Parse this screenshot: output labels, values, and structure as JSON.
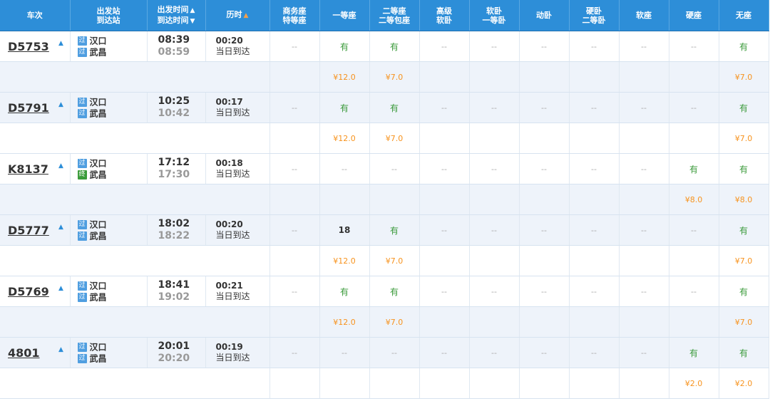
{
  "headers": {
    "train": "车次",
    "station_from": "出发站",
    "station_to": "到达站",
    "time_depart": "出发时间",
    "time_arrive": "到达时间",
    "duration": "历时",
    "business_1": "商务座",
    "business_2": "特等座",
    "first": "一等座",
    "second_1": "二等座",
    "second_2": "二等包座",
    "high_1": "高级",
    "high_2": "软卧",
    "soft_sleep_1": "软卧",
    "soft_sleep_2": "一等卧",
    "dong_sleep": "动卧",
    "hard_sleep_1": "硬卧",
    "hard_sleep_2": "二等卧",
    "soft_seat": "软座",
    "hard_seat": "硬座",
    "no_seat": "无座"
  },
  "icons": {
    "tag_pass": "过",
    "tag_end": "终",
    "sort_up": "▲",
    "sort_down": "▼"
  },
  "colors": {
    "header_bg": "#2d8ed8",
    "available": "#3a9a3a",
    "price": "#f7931e"
  },
  "trains": [
    {
      "no": "D5753",
      "from": "汉口",
      "to": "武昌",
      "to_tag": "过",
      "depart": "08:39",
      "arrive": "08:59",
      "duration": "00:20",
      "arrive_day": "当日到达",
      "seats": [
        "--",
        "有",
        "有",
        "--",
        "--",
        "--",
        "--",
        "--",
        "--",
        "有"
      ],
      "prices": [
        "",
        "¥12.0",
        "¥7.0",
        "",
        "",
        "",
        "",
        "",
        "",
        "¥7.0"
      ]
    },
    {
      "no": "D5791",
      "from": "汉口",
      "to": "武昌",
      "to_tag": "过",
      "depart": "10:25",
      "arrive": "10:42",
      "duration": "00:17",
      "arrive_day": "当日到达",
      "seats": [
        "--",
        "有",
        "有",
        "--",
        "--",
        "--",
        "--",
        "--",
        "--",
        "有"
      ],
      "prices": [
        "",
        "¥12.0",
        "¥7.0",
        "",
        "",
        "",
        "",
        "",
        "",
        "¥7.0"
      ]
    },
    {
      "no": "K8137",
      "from": "汉口",
      "to": "武昌",
      "to_tag": "终",
      "depart": "17:12",
      "arrive": "17:30",
      "duration": "00:18",
      "arrive_day": "当日到达",
      "seats": [
        "--",
        "--",
        "--",
        "--",
        "--",
        "--",
        "--",
        "--",
        "有",
        "有"
      ],
      "prices": [
        "",
        "",
        "",
        "",
        "",
        "",
        "",
        "",
        "¥8.0",
        "¥8.0"
      ]
    },
    {
      "no": "D5777",
      "from": "汉口",
      "to": "武昌",
      "to_tag": "过",
      "depart": "18:02",
      "arrive": "18:22",
      "duration": "00:20",
      "arrive_day": "当日到达",
      "seats": [
        "--",
        "18",
        "有",
        "--",
        "--",
        "--",
        "--",
        "--",
        "--",
        "有"
      ],
      "prices": [
        "",
        "¥12.0",
        "¥7.0",
        "",
        "",
        "",
        "",
        "",
        "",
        "¥7.0"
      ]
    },
    {
      "no": "D5769",
      "from": "汉口",
      "to": "武昌",
      "to_tag": "过",
      "depart": "18:41",
      "arrive": "19:02",
      "duration": "00:21",
      "arrive_day": "当日到达",
      "seats": [
        "--",
        "有",
        "有",
        "--",
        "--",
        "--",
        "--",
        "--",
        "--",
        "有"
      ],
      "prices": [
        "",
        "¥12.0",
        "¥7.0",
        "",
        "",
        "",
        "",
        "",
        "",
        "¥7.0"
      ]
    },
    {
      "no": "4801",
      "from": "汉口",
      "to": "武昌",
      "to_tag": "过",
      "depart": "20:01",
      "arrive": "20:20",
      "duration": "00:19",
      "arrive_day": "当日到达",
      "seats": [
        "--",
        "--",
        "--",
        "--",
        "--",
        "--",
        "--",
        "--",
        "有",
        "有"
      ],
      "prices": [
        "",
        "",
        "",
        "",
        "",
        "",
        "",
        "",
        "¥2.0",
        "¥2.0"
      ]
    }
  ]
}
